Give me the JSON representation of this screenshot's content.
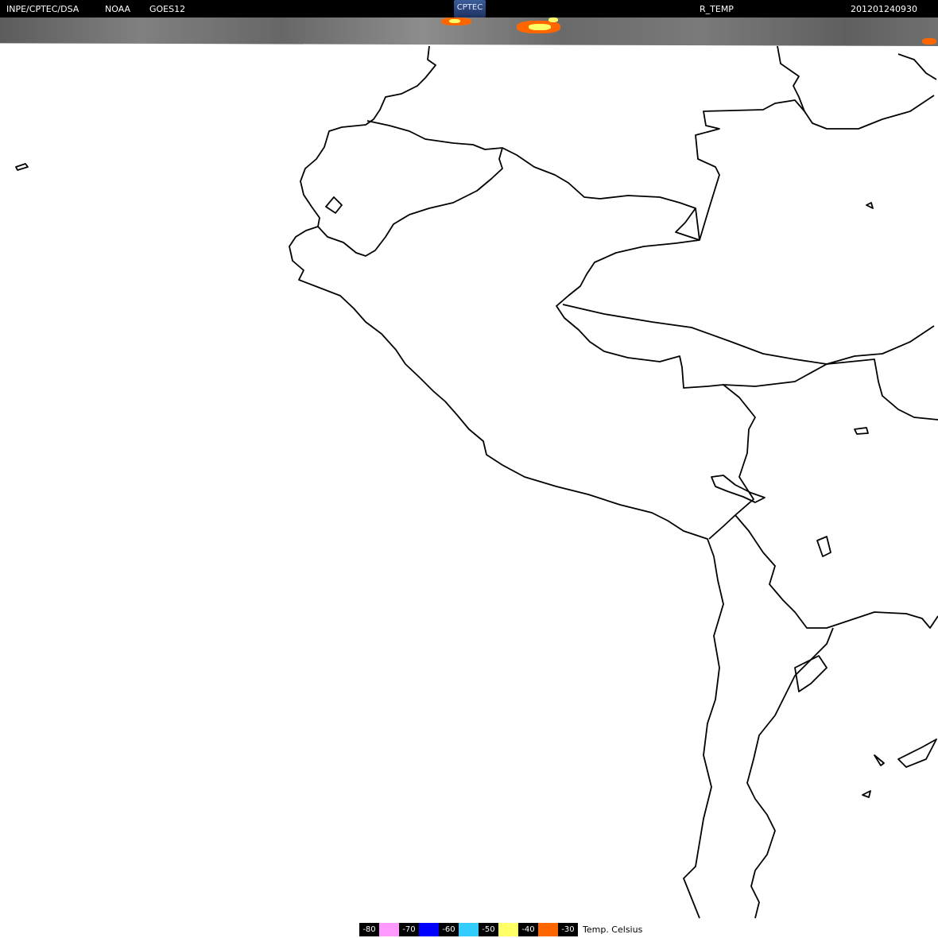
{
  "header": {
    "source": "INPE/CPTEC/DSA",
    "agency": "NOAA",
    "satellite": "GOES12",
    "product": "R_TEMP",
    "timestamp": "201201240930",
    "logo_text": "CPTEC"
  },
  "legend": {
    "items": [
      {
        "label": "-80",
        "color": "#ff99ff"
      },
      {
        "label": "-70",
        "color": "#0000ff"
      },
      {
        "label": "-60",
        "color": "#33ccff"
      },
      {
        "label": "-50",
        "color": "#ffff66"
      },
      {
        "label": "-40",
        "color": "#ff6600"
      },
      {
        "label": "-30",
        "color": "#000000"
      }
    ],
    "unit": "Temp. Celsius"
  },
  "colors": {
    "background": "#ffffff",
    "borders": "#000000",
    "cloud_band": "#7a7a7a"
  }
}
